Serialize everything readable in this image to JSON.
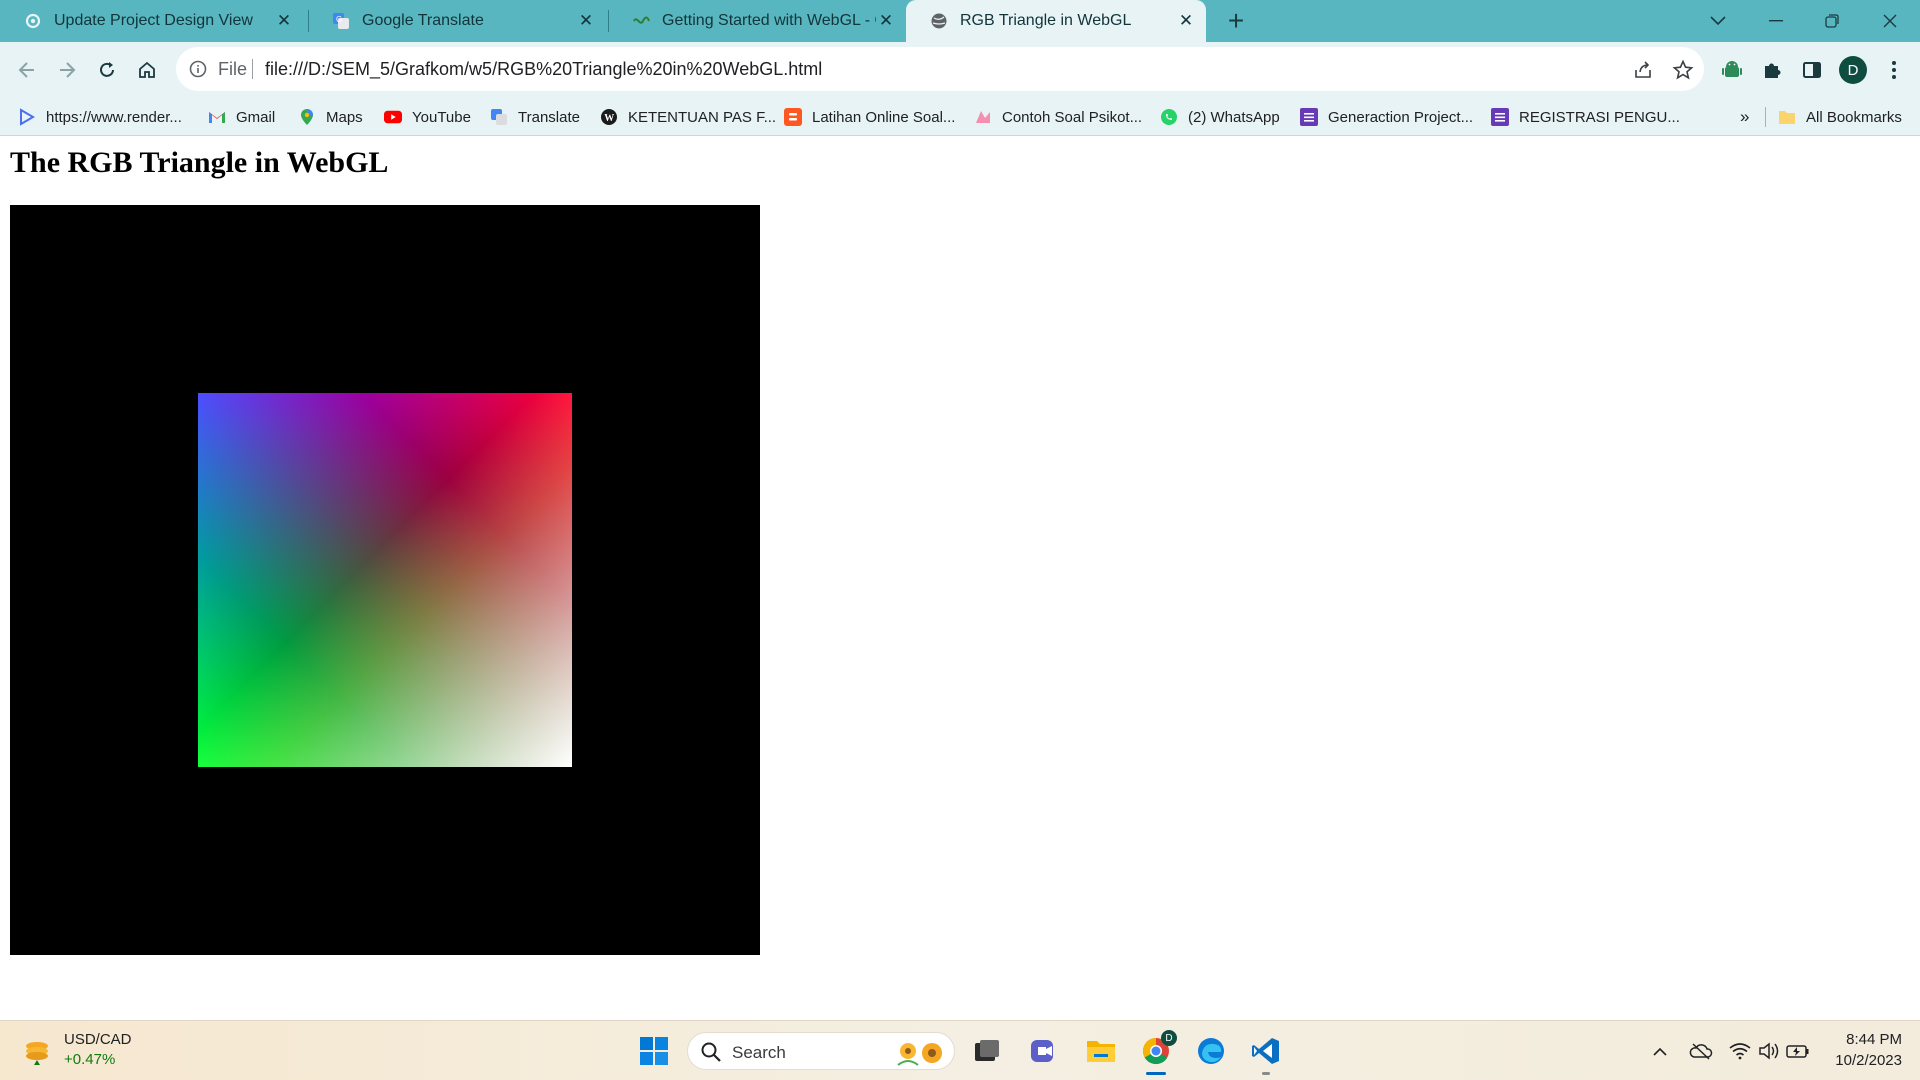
{
  "browser": {
    "tabs": [
      {
        "title": "Update Project Design View",
        "icon": "gear-favicon",
        "active": false
      },
      {
        "title": "Google Translate",
        "icon": "google-translate-favicon",
        "active": false
      },
      {
        "title": "Getting Started with WebGL - Gi",
        "icon": "webgl-favicon",
        "active": false
      },
      {
        "title": "RGB Triangle in WebGL",
        "icon": "globe-favicon",
        "active": true
      }
    ],
    "address": {
      "scheme_label": "File",
      "url": "file:///D:/SEM_5/Grafkom/w5/RGB%20Triangle%20in%20WebGL.html"
    },
    "profile_initial": "D",
    "bookmarks": [
      {
        "label": "https://www.render...",
        "icon": "render-icon"
      },
      {
        "label": "Gmail",
        "icon": "gmail-icon"
      },
      {
        "label": "Maps",
        "icon": "maps-icon"
      },
      {
        "label": "YouTube",
        "icon": "youtube-icon"
      },
      {
        "label": "Translate",
        "icon": "translate-icon"
      },
      {
        "label": "KETENTUAN PAS F...",
        "icon": "wordpress-icon"
      },
      {
        "label": "Latihan Online Soal...",
        "icon": "blogger-icon"
      },
      {
        "label": "Contoh Soal Psikot...",
        "icon": "site-icon"
      },
      {
        "label": "(2) WhatsApp",
        "icon": "whatsapp-icon"
      },
      {
        "label": "Generaction Project...",
        "icon": "forms-icon"
      },
      {
        "label": "REGISTRASI PENGU...",
        "icon": "forms-icon"
      }
    ],
    "bookmarks_overflow": "»",
    "all_bookmarks_label": "All Bookmarks"
  },
  "page": {
    "heading": "The RGB Triangle in WebGL",
    "canvas": {
      "background": "#000000",
      "corner_colors": {
        "top_left": "#0000ff",
        "top_right": "#ff0000",
        "bottom_left": "#00ff00",
        "bottom_right": "#ffffff"
      }
    }
  },
  "taskbar": {
    "widget": {
      "title": "USD/CAD",
      "change": "+0.47%"
    },
    "search_label": "Search",
    "apps": [
      "windows-start",
      "search",
      "task-view",
      "teams-meet",
      "file-explorer",
      "chrome",
      "edge",
      "vscode"
    ],
    "chrome_badge": "D",
    "clock": {
      "time": "8:44 PM",
      "date": "10/2/2023"
    }
  },
  "colors": {
    "tabstrip": "#58b6c0",
    "toolbar": "#e7f3f4",
    "accent": "#0067c0"
  }
}
